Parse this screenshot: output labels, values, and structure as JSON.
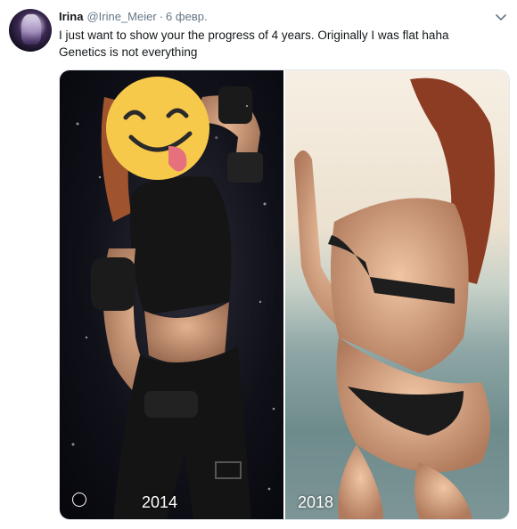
{
  "tweet": {
    "name": "Irina",
    "handle": "@Irine_Meier",
    "separator": "·",
    "date": "6 февр.",
    "text_lines": [
      "I just want to show your the progress of 4 years. Originally I was flat haha",
      "Genetics is not everything"
    ]
  },
  "media": {
    "left_label": "2014",
    "right_label": "2018"
  },
  "icons": {
    "menu": "chevron-down-icon",
    "overlay": "smiling-face-with-tongue-icon"
  },
  "colors": {
    "text": "#14171a",
    "muted": "#657786",
    "border": "#e1e8ed",
    "emoji": "#f7c94a",
    "tongue": "#e6707c"
  }
}
